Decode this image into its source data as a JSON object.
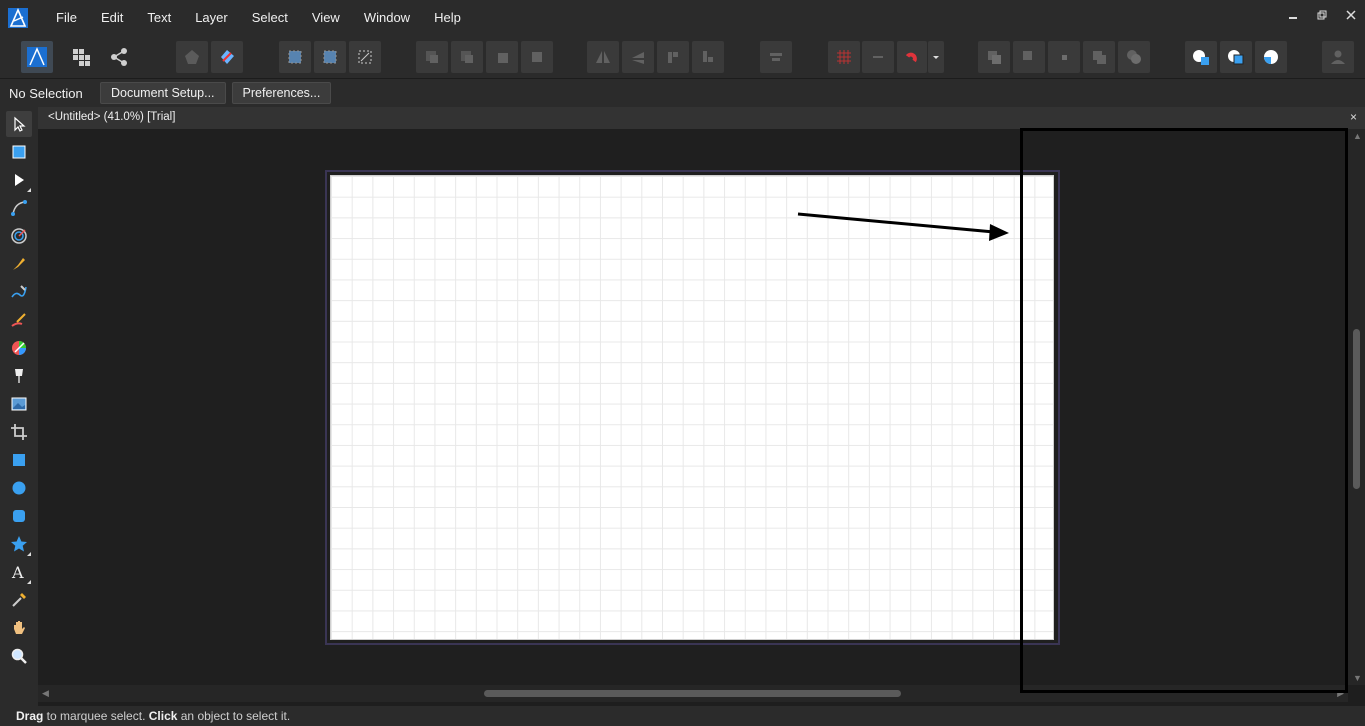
{
  "menubar": {
    "items": [
      "File",
      "Edit",
      "Text",
      "Layer",
      "Select",
      "View",
      "Window",
      "Help"
    ]
  },
  "context": {
    "selection_label": "No Selection",
    "document_setup_label": "Document Setup...",
    "preferences_label": "Preferences..."
  },
  "document": {
    "tab_title": "<Untitled> (41.0%) [Trial]",
    "close_glyph": "×"
  },
  "statusbar": {
    "drag_label": "Drag",
    "drag_text": " to marquee select. ",
    "click_label": "Click",
    "click_text": " an object to select it."
  },
  "colors": {
    "accent_blue": "#3aa0f0",
    "background": "#1f1f1f",
    "panel": "#2b2b2b",
    "artboard": "#ffffff"
  }
}
